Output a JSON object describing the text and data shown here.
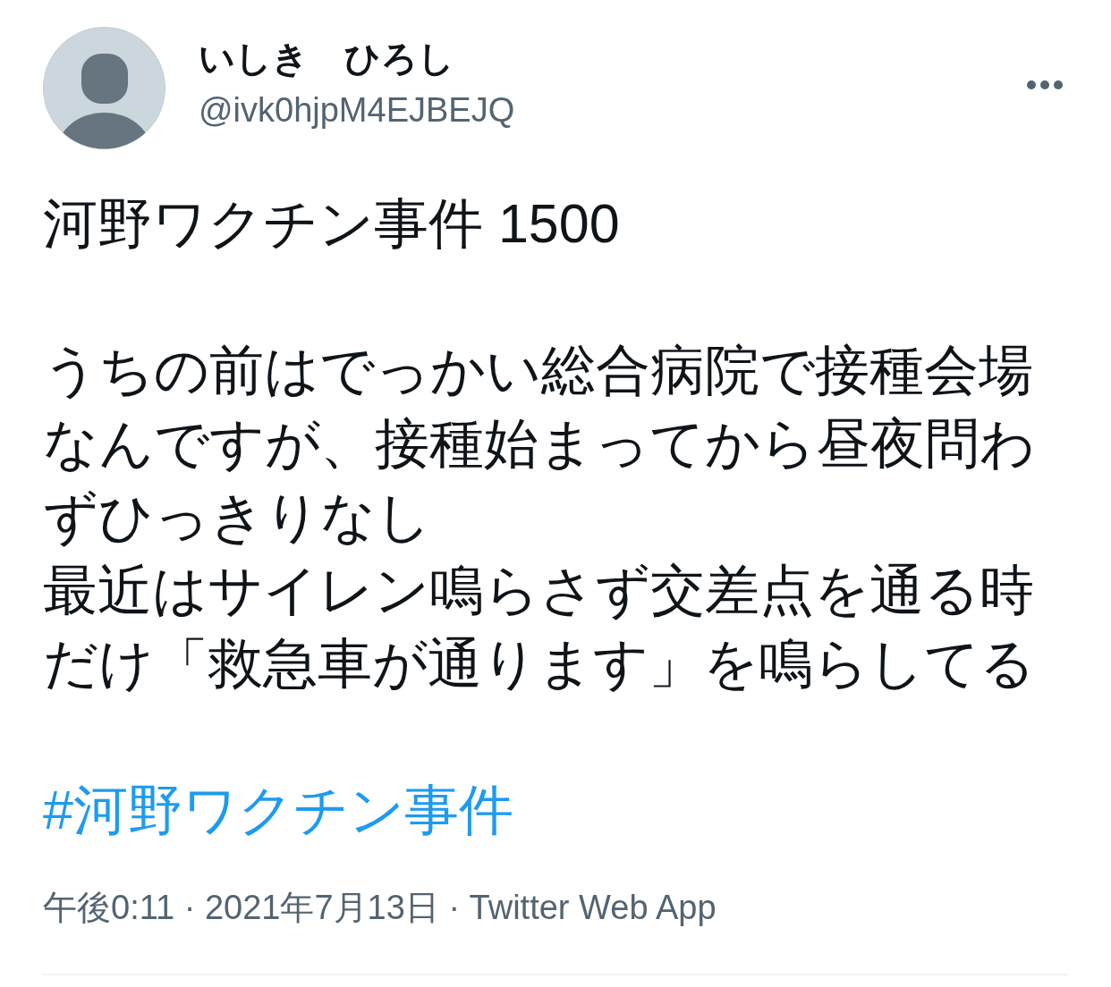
{
  "author": {
    "name": "いしき　ひろし",
    "handle": "@ivk0hjpM4EJBEJQ"
  },
  "tweet": {
    "paragraphs": [
      {
        "lines": [
          "河野ワクチン事件 1500"
        ]
      },
      {
        "lines": [
          "うちの前はでっかい総合病院で接種会場なんですが、接種始まってから昼夜問わずひっきりなし",
          "最近はサイレン鳴らさず交差点を通る時だけ「救急車が通ります」を鳴らしてる"
        ]
      }
    ],
    "hashtag": "#河野ワクチン事件",
    "timestamp": "午後0:11 · 2021年7月13日 · Twitter Web App"
  }
}
